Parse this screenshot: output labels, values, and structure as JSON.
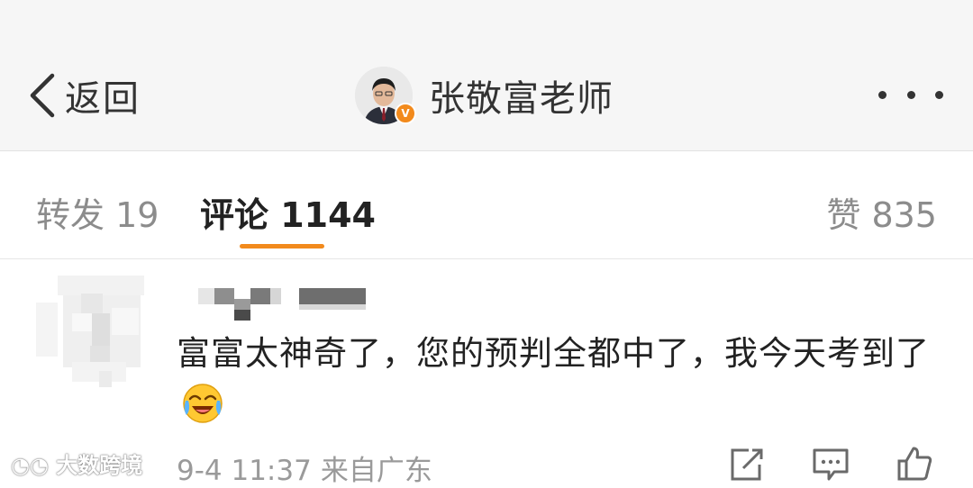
{
  "navbar": {
    "back_label": "返回",
    "profile_name": "张敬富老师",
    "verified_badge": "V",
    "icons": {
      "back": "chevron-left-icon",
      "more": "more-dots-icon"
    }
  },
  "tabs": {
    "repost": "转发 19",
    "comments": "评论 1144",
    "likes": "赞 835",
    "active": "comments",
    "accent_color": "#f28a1c"
  },
  "comment": {
    "username_blurred": true,
    "text": "富富太神奇了，您的预判全都中了，我今天考到了",
    "emoji": "laughing-crying-emoji",
    "time": "9-4 11:37",
    "source": "来自广东",
    "actions": [
      "share-icon",
      "comment-icon",
      "like-icon"
    ]
  },
  "watermark": "大数跨境"
}
